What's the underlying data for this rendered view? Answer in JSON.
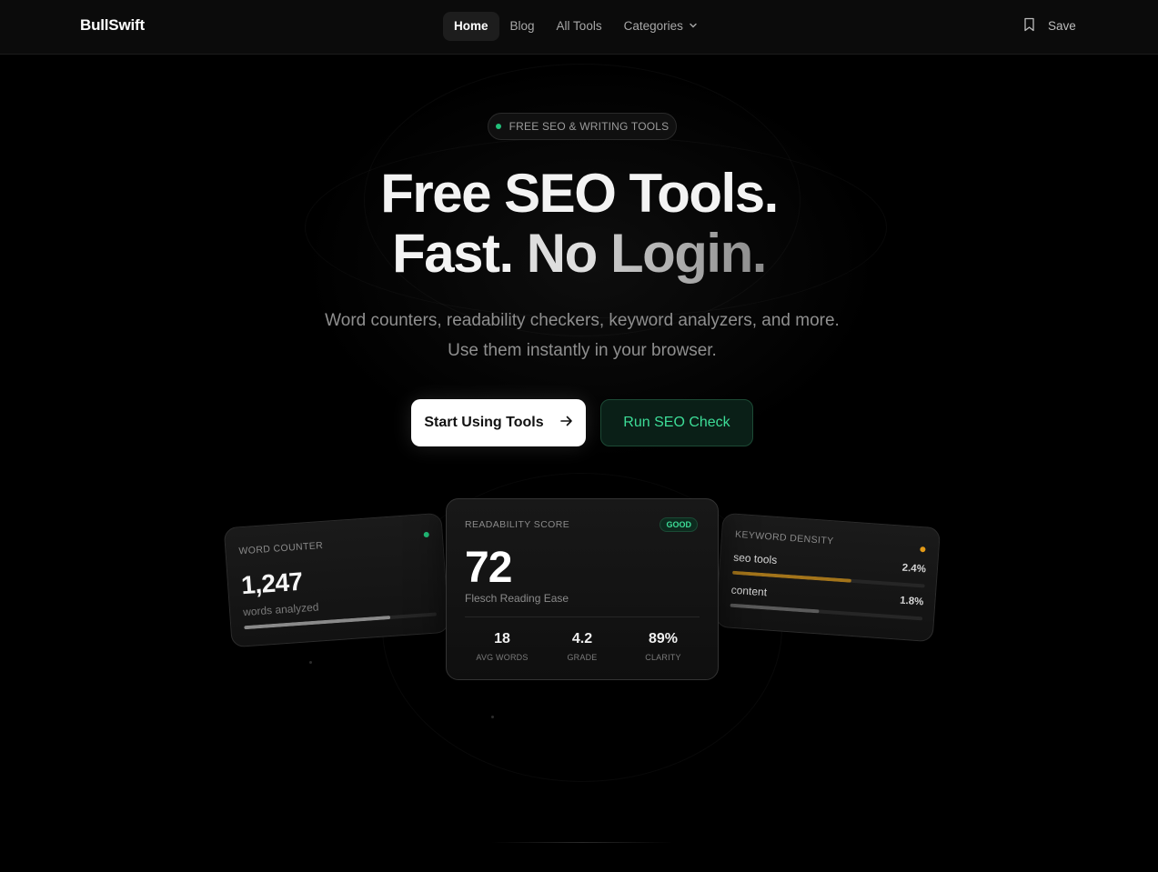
{
  "nav": {
    "logo": "BullSwift",
    "links": [
      "Home",
      "Blog",
      "All Tools",
      "Categories"
    ],
    "save_label": "Save"
  },
  "hero": {
    "badge": "FREE SEO & WRITING TOOLS",
    "headline_line1": "Free SEO Tools.",
    "headline_line2_a": "Fast.",
    "headline_line2_b": "No",
    "headline_line2_c": "Login.",
    "subheadline": "Word counters, readability checkers, keyword analyzers, and more. Use them instantly in your browser.",
    "primary_cta": "Start Using Tools",
    "secondary_cta": "Run SEO Check"
  },
  "cards": {
    "word_counter": {
      "label": "WORD COUNTER",
      "value": "1,247",
      "sub": "words analyzed",
      "progress": 0.76
    },
    "readability": {
      "label": "READABILITY SCORE",
      "badge": "GOOD",
      "value": "72",
      "sub": "Flesch Reading Ease",
      "stats": [
        {
          "value": "18",
          "label": "AVG WORDS"
        },
        {
          "value": "4.2",
          "label": "GRADE"
        },
        {
          "value": "89%",
          "label": "CLARITY"
        }
      ]
    },
    "keyword_density": {
      "label": "KEYWORD DENSITY",
      "keywords": [
        {
          "term": "seo tools",
          "pct": "2.4%",
          "progress": 0.62
        },
        {
          "term": "content",
          "pct": "1.8%",
          "progress": 0.46
        }
      ]
    }
  },
  "colors": {
    "accent_green": "#3ddc97",
    "accent_orange": "#e39a17",
    "background": "#000000"
  }
}
